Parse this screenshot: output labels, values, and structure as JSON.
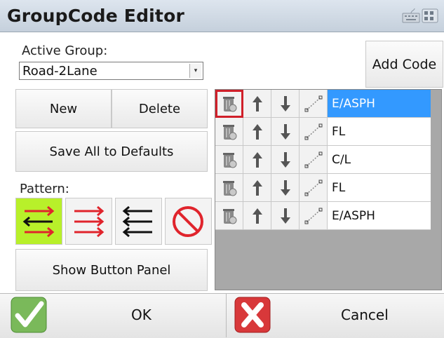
{
  "window": {
    "title": "GroupCode Editor",
    "keyboard_icon": "keyboard-icon"
  },
  "active_group": {
    "label": "Active Group:",
    "value": "Road-2Lane"
  },
  "buttons": {
    "add_code": "Add Code",
    "new": "New",
    "delete": "Delete",
    "save_defaults": "Save All to Defaults",
    "show_panel": "Show Button Panel"
  },
  "pattern": {
    "label": "Pattern:",
    "options": [
      "alternating-arrows-icon",
      "right-arrows-icon",
      "left-arrows-icon",
      "no-pattern-icon"
    ],
    "selected_index": 0
  },
  "codes": [
    {
      "name": "E/ASPH",
      "selected": true
    },
    {
      "name": "FL",
      "selected": false
    },
    {
      "name": "C/L",
      "selected": false
    },
    {
      "name": "FL",
      "selected": false
    },
    {
      "name": "E/ASPH",
      "selected": false
    }
  ],
  "footer": {
    "ok": "OK",
    "cancel": "Cancel"
  },
  "colors": {
    "selection": "#3399ff",
    "highlight": "#d0202a",
    "pattern_selected": "#b8f02a"
  }
}
